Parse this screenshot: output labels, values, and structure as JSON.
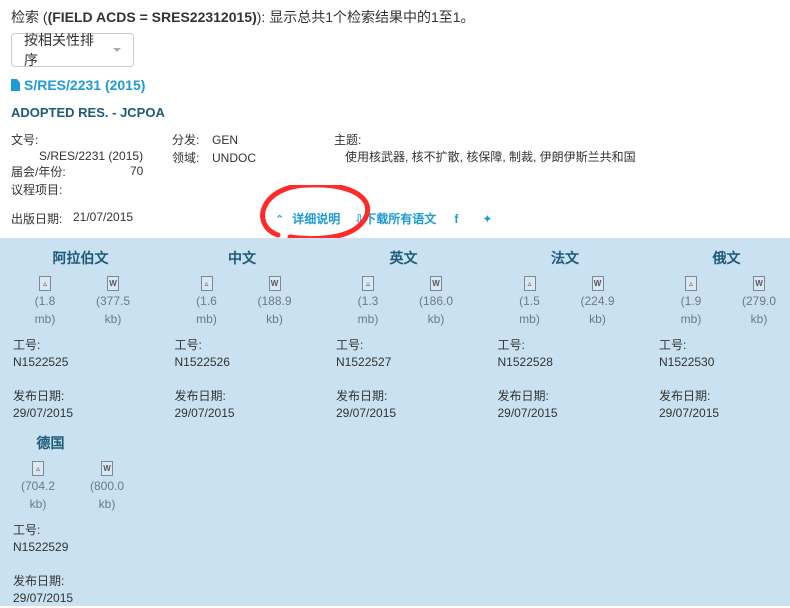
{
  "search": {
    "prefix": "检索 (",
    "query": "(FIELD ACDS = SRES22312015)",
    "suffix": "): 显示总共1个检索结果中的1至1。"
  },
  "sort": {
    "label": "按相关性排序"
  },
  "document": {
    "symbol_link": "S/RES/2231 (2015)",
    "title": "ADOPTED RES. - JCPOA",
    "labels": {
      "symbol": "文号:",
      "session": "届会/年份:",
      "agenda": "议程项目:",
      "distribution": "分发:",
      "area": "领域:",
      "subjects": "主题:",
      "pub_date": "出版日期:"
    },
    "symbol": "S/RES/2231 (2015)",
    "session": "70",
    "distribution": "GEN",
    "area": "UNDOC",
    "subjects": "使用核武器, 核不扩散, 核保障, 制裁, 伊朗伊斯兰共和国",
    "pub_date": "21/07/2015"
  },
  "actions": {
    "details": "详细说明",
    "download_all": "下载所有语文",
    "facebook": "f",
    "twitter": "t"
  },
  "accent": "#1e9ad6",
  "languages": [
    {
      "name": "阿拉伯文",
      "pdf": [
        "(1.8",
        "mb)"
      ],
      "doc": [
        "(377.5",
        "kb)"
      ],
      "job_label": "工号:",
      "job": "N1522525",
      "date_label": "发布日期:",
      "date": "29/07/2015"
    },
    {
      "name": "中文",
      "pdf": [
        "(1.6",
        "mb)"
      ],
      "doc": [
        "(188.9",
        "kb)"
      ],
      "job_label": "工号:",
      "job": "N1522526",
      "date_label": "发布日期:",
      "date": "29/07/2015"
    },
    {
      "name": "英文",
      "pdf": [
        "(1.3",
        "mb)"
      ],
      "doc": [
        "(186.0",
        "kb)"
      ],
      "job_label": "工号:",
      "job": "N1522527",
      "date_label": "发布日期:",
      "date": "29/07/2015"
    },
    {
      "name": "法文",
      "pdf": [
        "(1.5",
        "mb)"
      ],
      "doc": [
        "(224.9",
        "kb)"
      ],
      "job_label": "工号:",
      "job": "N1522528",
      "date_label": "发布日期:",
      "date": "29/07/2015"
    },
    {
      "name": "俄文",
      "pdf": [
        "(1.9",
        "mb)"
      ],
      "doc": [
        "(279.0",
        "kb)"
      ],
      "job_label": "工号:",
      "job": "N1522530",
      "date_label": "发布日期:",
      "date": "29/07/2015"
    },
    {
      "name": "德国",
      "pdf": [
        "(704.2",
        "kb)"
      ],
      "doc": [
        "(800.0",
        "kb)"
      ],
      "job_label": "工号:",
      "job": "N1522529",
      "date_label": "发布日期:",
      "date": "29/07/2015"
    }
  ]
}
